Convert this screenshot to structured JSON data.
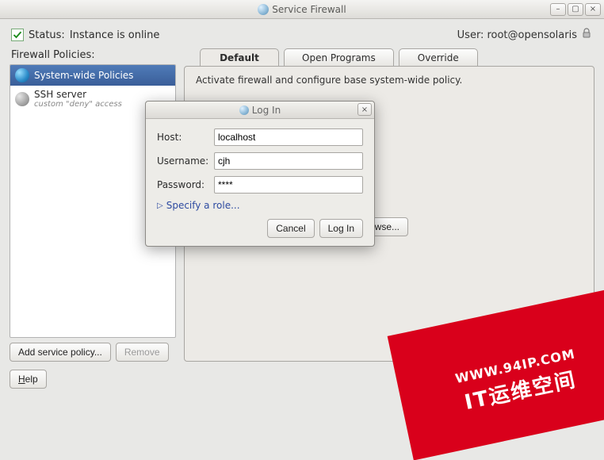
{
  "window": {
    "title": "Service Firewall",
    "minimize": "–",
    "maximize": "▢",
    "close": "×"
  },
  "status": {
    "label": "Status:",
    "text": "Instance is online",
    "user_label": "User:",
    "user_value": "root@opensolaris"
  },
  "sidebar": {
    "heading": "Firewall Policies:",
    "items": [
      {
        "label": "System-wide Policies",
        "sub": ""
      },
      {
        "label": "SSH server",
        "sub": "custom \"deny\" access"
      }
    ],
    "add_label": "Add service policy...",
    "remove_label": "Remove"
  },
  "tabs": {
    "items": [
      {
        "label": "Default"
      },
      {
        "label": "Open Programs"
      },
      {
        "label": "Override"
      }
    ],
    "panel_desc": "Activate firewall and configure base system-wide policy.",
    "browse_label": "Browse..."
  },
  "bottom": {
    "help_prefix": "H",
    "help_rest": "elp"
  },
  "dialog": {
    "title": "Log In",
    "host_label": "Host:",
    "host_value": "localhost",
    "user_label": "Username:",
    "user_value": "cjh",
    "pass_label": "Password:",
    "pass_value": "****",
    "specify": "Specify a role...",
    "cancel": "Cancel",
    "login": "Log In",
    "close": "×"
  },
  "watermark": {
    "line1": "WWW.94IP.COM",
    "line2": "IT运维空间"
  }
}
